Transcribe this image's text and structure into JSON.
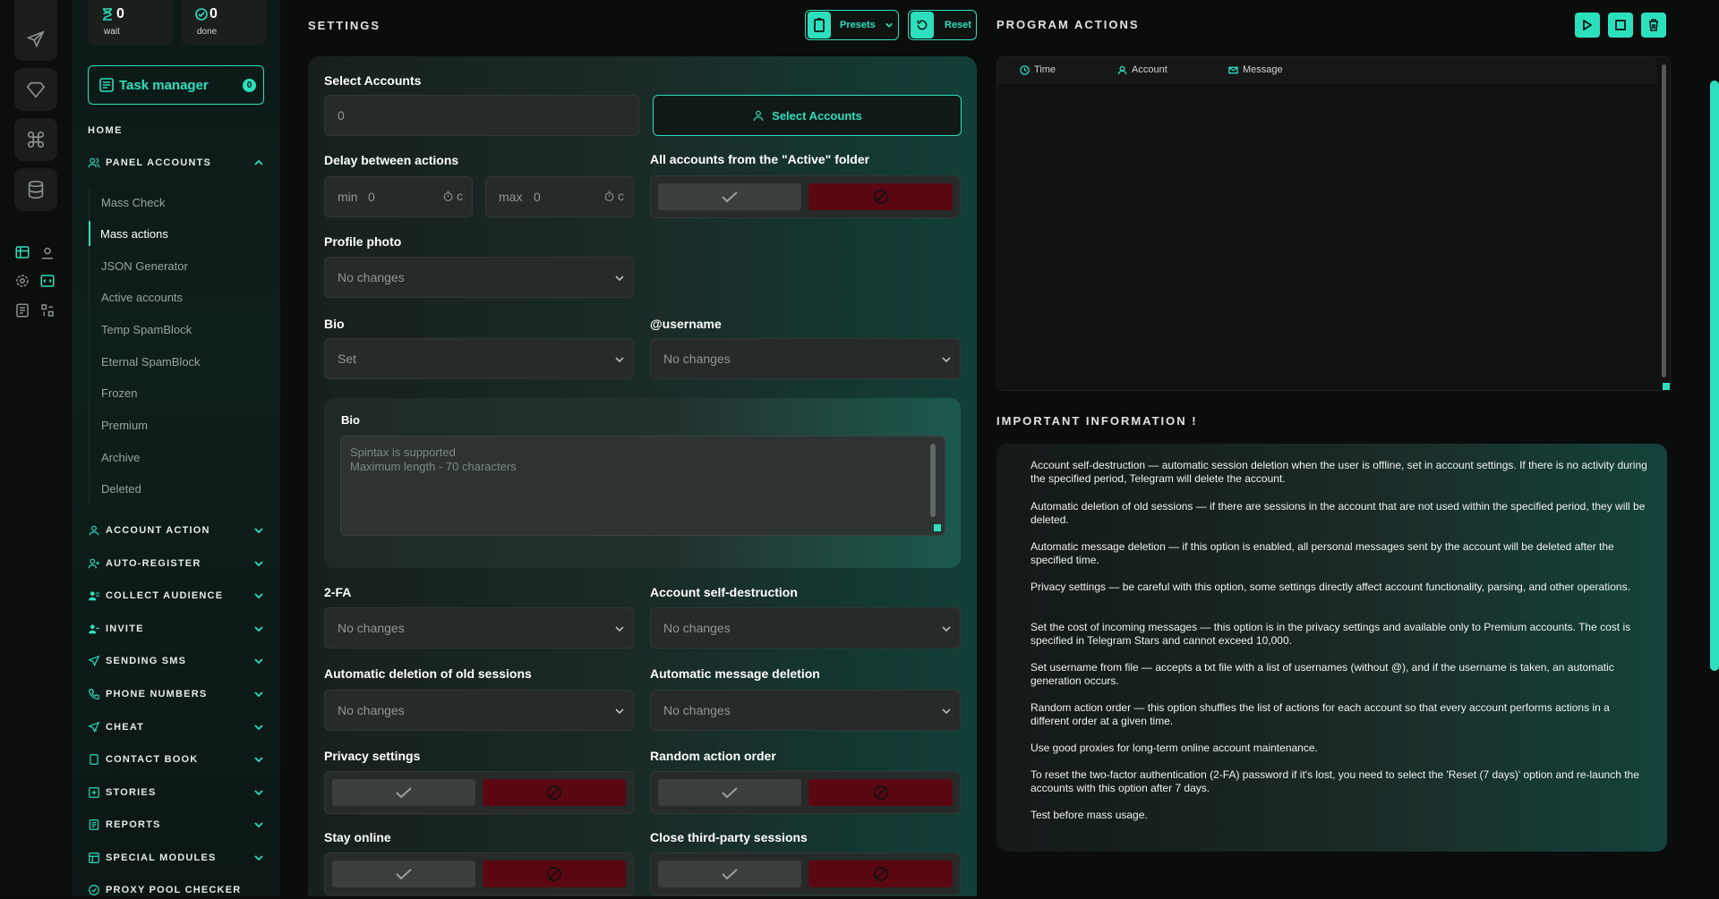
{
  "stats": {
    "wait_num": "0",
    "wait_label": "wait",
    "done_num": "0",
    "done_label": "done"
  },
  "task_manager": {
    "label": "Task manager",
    "badge": "0"
  },
  "nav": {
    "home": "HOME",
    "panel_accounts": "PANEL ACCOUNTS",
    "sub_items": [
      "Mass Check",
      "Mass actions",
      "JSON Generator",
      "Active accounts",
      "Temp SpamBlock",
      "Eternal SpamBlock",
      "Frozen",
      "Premium",
      "Archive",
      "Deleted"
    ],
    "sections": [
      "ACCOUNT ACTION",
      "AUTO-REGISTER",
      "COLLECT AUDIENCE",
      "INVITE",
      "SENDING SMS",
      "PHONE NUMBERS",
      "CHEAT",
      "CONTACT BOOK",
      "STORIES",
      "REPORTS",
      "SPECIAL MODULES",
      "PROXY POOL CHECKER"
    ]
  },
  "settings": {
    "title": "SETTINGS",
    "presets_label": "Presets",
    "reset_label": "Reset",
    "select_accounts_label": "Select Accounts",
    "select_accounts_value": "0",
    "select_accounts_button": "Select Accounts",
    "delay_label": "Delay between actions",
    "delay_min_label": "min",
    "delay_min_value": "0",
    "delay_max_label": "max",
    "delay_max_value": "0",
    "delay_unit": "c",
    "active_folder_label": "All accounts from the \"Active\" folder",
    "profile_photo_label": "Profile photo",
    "profile_photo_value": "No changes",
    "bio_label": "Bio",
    "bio_value": "Set",
    "username_label": "@username",
    "username_value": "No changes",
    "bio_box_label": "Bio",
    "bio_placeholder_1": "Spintax is supported",
    "bio_placeholder_2": "Maximum length - 70 characters",
    "twofa_label": "2-FA",
    "twofa_value": "No changes",
    "self_destruct_label": "Account self-destruction",
    "self_destruct_value": "No changes",
    "old_sessions_label": "Automatic deletion of old sessions",
    "old_sessions_value": "No changes",
    "msg_deletion_label": "Automatic message deletion",
    "msg_deletion_value": "No changes",
    "privacy_label": "Privacy settings",
    "random_order_label": "Random action order",
    "stay_online_label": "Stay online",
    "close_sessions_label": "Close third-party sessions"
  },
  "program": {
    "title": "PROGRAM ACTIONS",
    "columns": [
      "Time",
      "Account",
      "Message"
    ]
  },
  "info": {
    "title": "IMPORTANT INFORMATION !",
    "paragraphs": [
      "Account self-destruction — automatic session deletion when the user is offline, set in account settings. If there is no activity during the specified period, Telegram will delete the account.",
      "Automatic deletion of old sessions — if there are sessions in the account that are not used within the specified period, they will be deleted.",
      "Automatic message deletion — if this option is enabled, all personal messages sent by the account will be deleted after the specified time.",
      "Privacy settings — be careful with this option, some settings directly affect account functionality, parsing, and other operations.",
      "Set the cost of incoming messages — this option is in the privacy settings and available only to Premium accounts. The cost is specified in Telegram Stars and cannot exceed 10,000.",
      "Set username from file — accepts a txt file with a list of usernames (without @), and if the username is taken, an automatic generation occurs.",
      "Random action order — this option shuffles the list of actions for each account so that every account performs actions in a different order at a given time.",
      "Use good proxies for long-term online account maintenance.",
      "To reset the two-factor authentication (2-FA) password if it's lost, you need to select the 'Reset (7 days)' option and re-launch the accounts with this option after 7 days.",
      "Test before mass usage."
    ]
  },
  "colors": {
    "accent": "#2de0bd",
    "danger": "#5b0712",
    "background": "#0b0c0c"
  }
}
